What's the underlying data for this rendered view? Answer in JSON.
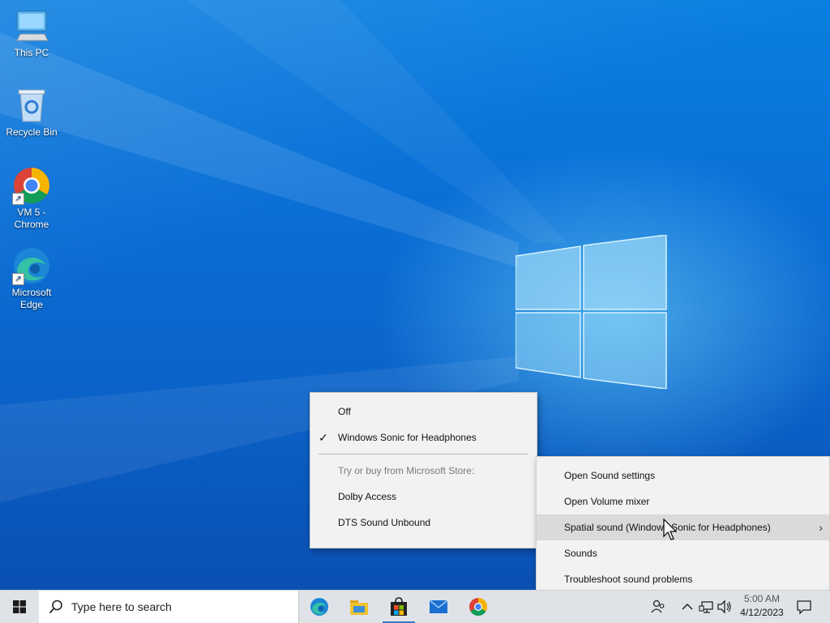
{
  "desktop_icons": [
    {
      "label": "This PC",
      "icon": "this-pc-icon"
    },
    {
      "label": "Recycle Bin",
      "icon": "recycle-bin-icon"
    },
    {
      "label": "VM 5 -\nChrome",
      "icon": "chrome-icon"
    },
    {
      "label": "Microsoft\nEdge",
      "icon": "edge-icon"
    }
  ],
  "spatial_menu": {
    "off": "Off",
    "windows_sonic": "Windows Sonic for Headphones",
    "store_header": "Try or buy from Microsoft Store:",
    "dolby": "Dolby Access",
    "dts": "DTS Sound Unbound"
  },
  "sound_menu": {
    "open_sound_settings": "Open Sound settings",
    "open_volume_mixer": "Open Volume mixer",
    "spatial_sound": "Spatial sound (Windows Sonic for Headphones)",
    "sounds": "Sounds",
    "troubleshoot": "Troubleshoot sound problems"
  },
  "taskbar": {
    "search_placeholder": "Type here to search",
    "apps": [
      "edge-icon",
      "file-explorer-icon",
      "microsoft-store-icon",
      "mail-icon",
      "chrome-icon"
    ],
    "clock_time": "5:00 AM",
    "clock_date": "4/12/2023"
  },
  "colors": {
    "accent": "#0a6fd6",
    "menu_bg": "#f2f2f2",
    "menu_hover": "#dadada",
    "taskbar_bg": "#dfe3e8"
  }
}
